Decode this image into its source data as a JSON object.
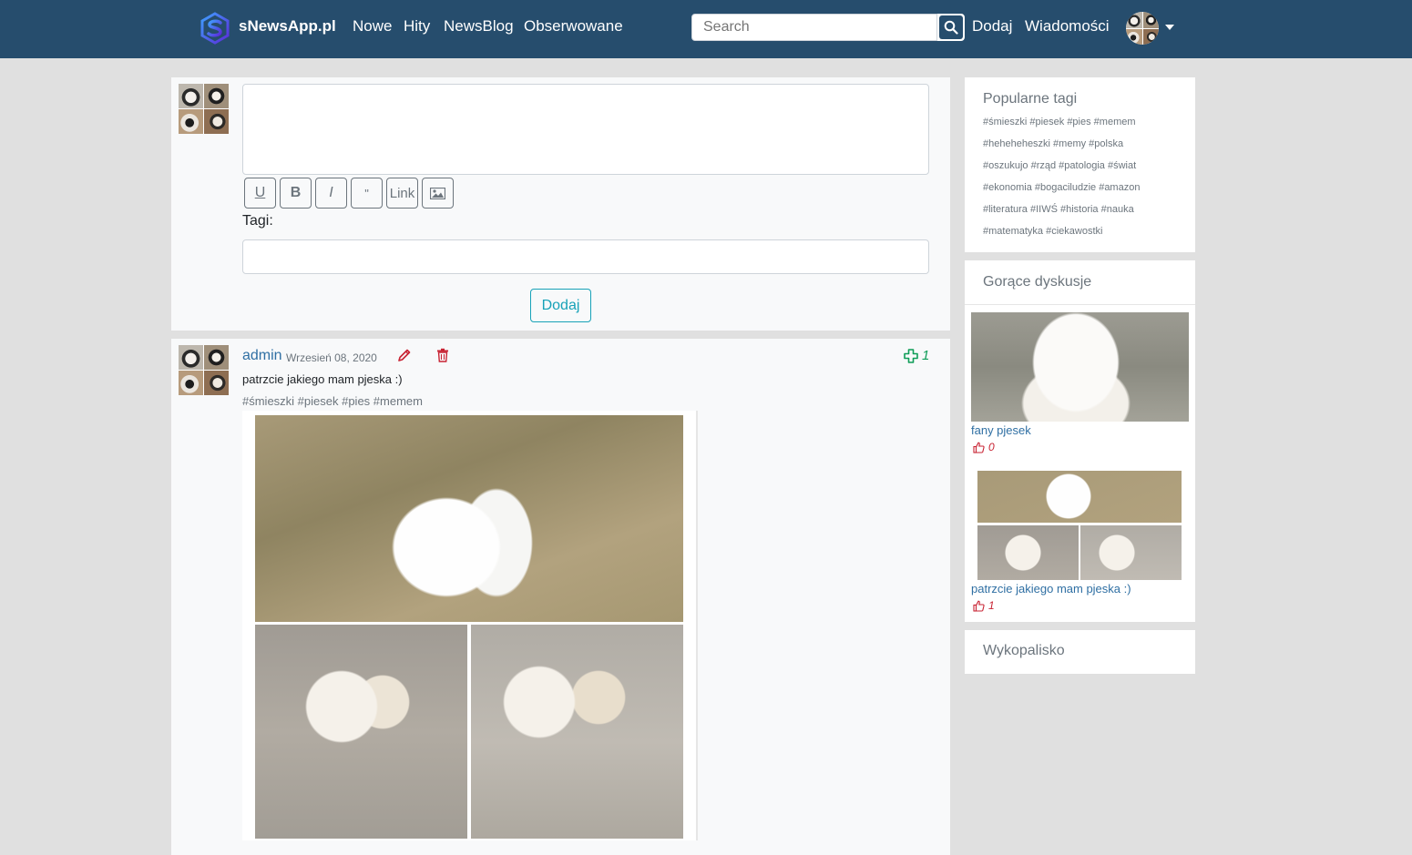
{
  "navbar": {
    "brand": "sNewsApp.pl",
    "links": [
      "Nowe",
      "Hity",
      "NewsBlog",
      "Obserwowane"
    ],
    "search_placeholder": "Search",
    "add": "Dodaj",
    "messages": "Wiadomości",
    "icons": {
      "logo": "s-logo-icon",
      "search": "search-icon",
      "caret": "caret-down-icon"
    }
  },
  "composer": {
    "format_buttons": [
      "U",
      "B",
      "I",
      "\"",
      "Link"
    ],
    "image_button_icon": "image-icon",
    "tags_label": "Tagi:",
    "submit": "Dodaj"
  },
  "post": {
    "author": "admin",
    "date": "Wrzesień 08, 2020",
    "text": "patrzcie jakiego mam pjeska :)",
    "tags": "#śmieszki #piesek #pies #memem",
    "score": "1",
    "icons": {
      "edit": "pencil-icon",
      "delete": "trash-icon",
      "vote": "plus-icon"
    }
  },
  "sidebar": {
    "popular_tags": {
      "title": "Popularne tagi",
      "lines": [
        "#śmieszki #piesek #pies #memem",
        "#heheheheszki #memy #polska",
        "#oszukujo #rząd #patologia #świat",
        "#ekonomia #bogaciludzie #amazon",
        "#literatura #IIWŚ #historia #nauka",
        "#matematyka #ciekawostki"
      ]
    },
    "hot": {
      "title": "Gorące dyskusje",
      "items": [
        {
          "title": "fany pjesek",
          "likes": "0"
        },
        {
          "title": "patrzcie jakiego mam pjeska :)",
          "likes": "1"
        }
      ]
    },
    "archive": {
      "title": "Wykopalisko"
    }
  },
  "colors": {
    "navbar": "#264d6d",
    "link": "#2f6fa3",
    "accent_teal": "#17a2b8",
    "danger": "#c82333",
    "success": "#0f9d58"
  }
}
